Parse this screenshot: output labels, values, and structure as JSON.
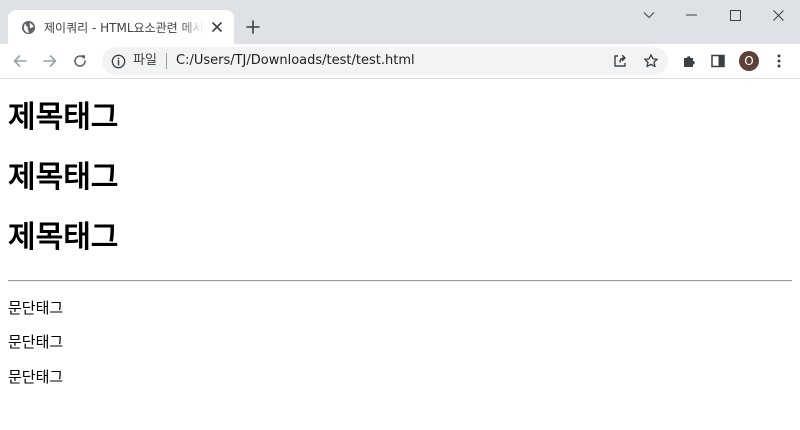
{
  "browser": {
    "tab": {
      "title": "제이쿼리 - HTML요소관련 메서드"
    },
    "omnibox": {
      "chip_label": "파일",
      "url": "C:/Users/TJ/Downloads/test/test.html"
    },
    "profile_initial": "O",
    "colors": {
      "tabstrip": "#dee1e6",
      "omnibox": "#f1f3f4",
      "avatar": "#5d4037"
    }
  },
  "page": {
    "headings": [
      "제목태그",
      "제목태그",
      "제목태그"
    ],
    "paragraphs": [
      "문단태그",
      "문단태그",
      "문단태그"
    ]
  },
  "icons": {
    "tab_favicon": "globe-icon",
    "tab_close": "close-icon",
    "new_tab": "plus-icon",
    "tab_search": "chevron-down-icon",
    "minimize": "minimize-icon",
    "maximize": "maximize-icon",
    "window_close": "close-icon",
    "back": "arrow-left-icon",
    "forward": "arrow-right-icon",
    "reload": "reload-icon",
    "site_info": "info-icon",
    "share": "share-icon",
    "bookmark": "star-icon",
    "extensions": "puzzle-icon",
    "side_panel": "side-panel-icon",
    "menu": "kebab-menu-icon"
  }
}
